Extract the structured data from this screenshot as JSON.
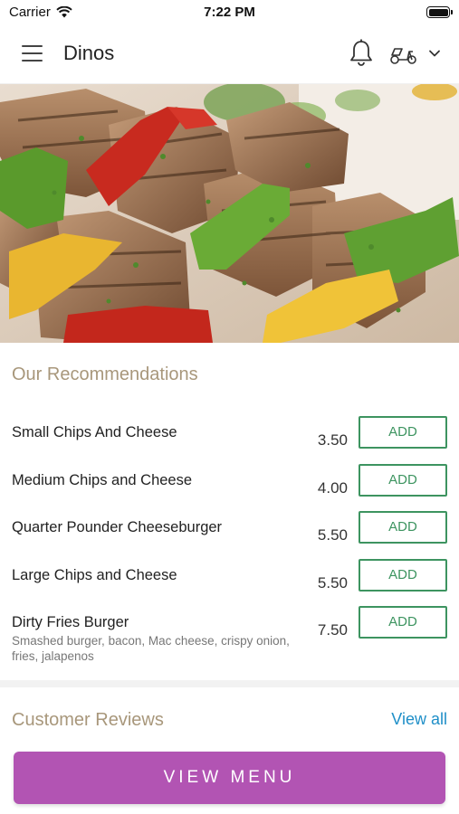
{
  "status_bar": {
    "carrier": "Carrier",
    "time": "7:22 PM"
  },
  "header": {
    "title": "Dinos",
    "icons": [
      "menu-icon",
      "bell-icon",
      "scooter-icon",
      "chevron-down-icon"
    ]
  },
  "recommendations": {
    "title": "Our Recommendations",
    "items": [
      {
        "name": "Small Chips And Cheese",
        "price": "3.50",
        "add_label": "ADD"
      },
      {
        "name": "Medium Chips and Cheese",
        "price": "4.00",
        "add_label": "ADD"
      },
      {
        "name": "Quarter Pounder Cheeseburger",
        "price": "5.50",
        "add_label": "ADD"
      },
      {
        "name": "Large Chips and Cheese",
        "price": "5.50",
        "add_label": "ADD"
      },
      {
        "name": "Dirty Fries Burger",
        "description": "Smashed burger, bacon, Mac cheese, crispy onion, fries, jalapenos",
        "price": "7.50",
        "add_label": "ADD"
      }
    ]
  },
  "reviews": {
    "title": "Customer Reviews",
    "view_all_label": "View all"
  },
  "view_menu_label": "VIEW MENU",
  "colors": {
    "section_title": "#a8977b",
    "add_button": "#3d9460",
    "link": "#1f8fc8",
    "primary_button": "#b254b3"
  }
}
